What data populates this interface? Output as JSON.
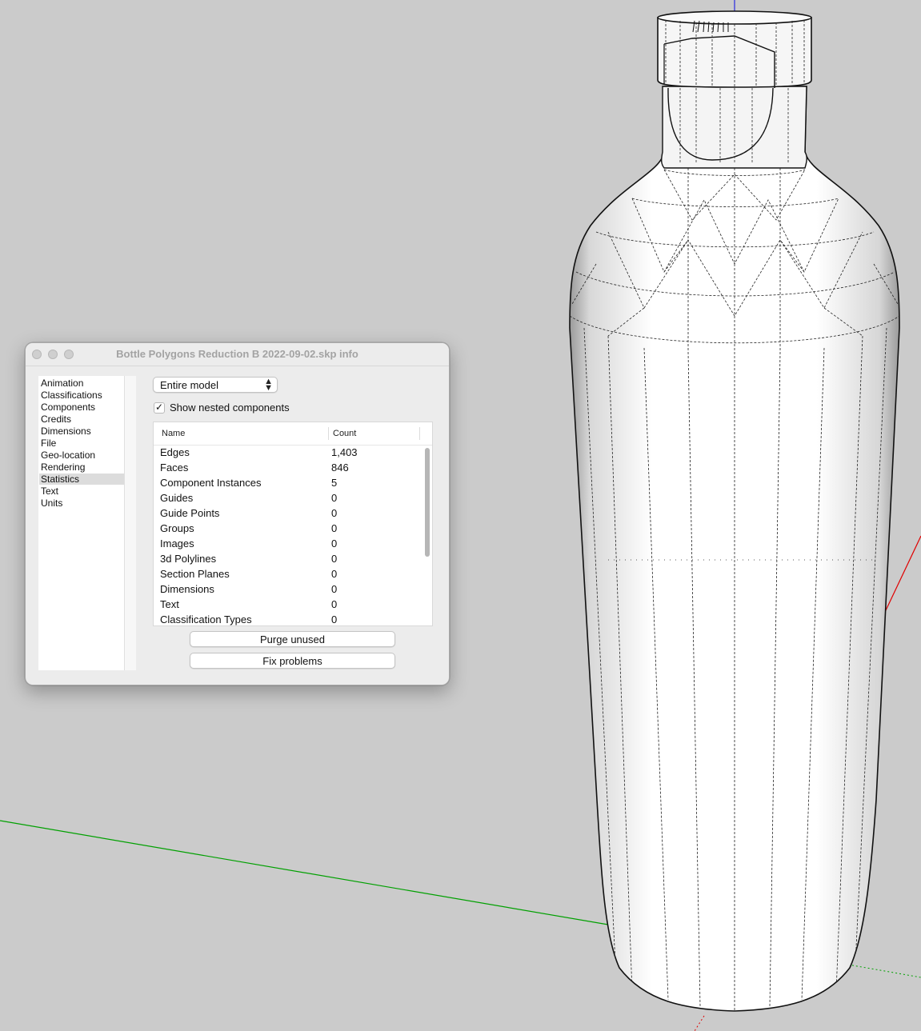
{
  "window": {
    "title": "Bottle Polygons Reduction B 2022-09-02.skp info"
  },
  "sidebar": {
    "items": [
      {
        "label": "Animation"
      },
      {
        "label": "Classifications"
      },
      {
        "label": "Components"
      },
      {
        "label": "Credits"
      },
      {
        "label": "Dimensions"
      },
      {
        "label": "File"
      },
      {
        "label": "Geo-location"
      },
      {
        "label": "Rendering"
      },
      {
        "label": "Statistics"
      },
      {
        "label": "Text"
      },
      {
        "label": "Units"
      }
    ],
    "selected": "Statistics"
  },
  "scope_select": {
    "value": "Entire model"
  },
  "nested_checkbox": {
    "label": "Show nested components",
    "checked": true
  },
  "table": {
    "headers": {
      "name": "Name",
      "count": "Count"
    },
    "rows": [
      {
        "name": "Edges",
        "count": "1,403"
      },
      {
        "name": "Faces",
        "count": "846"
      },
      {
        "name": "Component Instances",
        "count": "5"
      },
      {
        "name": "Guides",
        "count": "0"
      },
      {
        "name": "Guide Points",
        "count": "0"
      },
      {
        "name": "Groups",
        "count": "0"
      },
      {
        "name": "Images",
        "count": "0"
      },
      {
        "name": "3d Polylines",
        "count": "0"
      },
      {
        "name": "Section Planes",
        "count": "0"
      },
      {
        "name": "Dimensions",
        "count": "0"
      },
      {
        "name": "Text",
        "count": "0"
      },
      {
        "name": "Classification Types",
        "count": "0"
      }
    ]
  },
  "buttons": {
    "purge": "Purge unused",
    "fix": "Fix problems"
  },
  "colors": {
    "background": "#cbcbcb",
    "x_axis": "#e00000",
    "y_axis": "#00a000",
    "z_axis": "#2a2ae0"
  }
}
